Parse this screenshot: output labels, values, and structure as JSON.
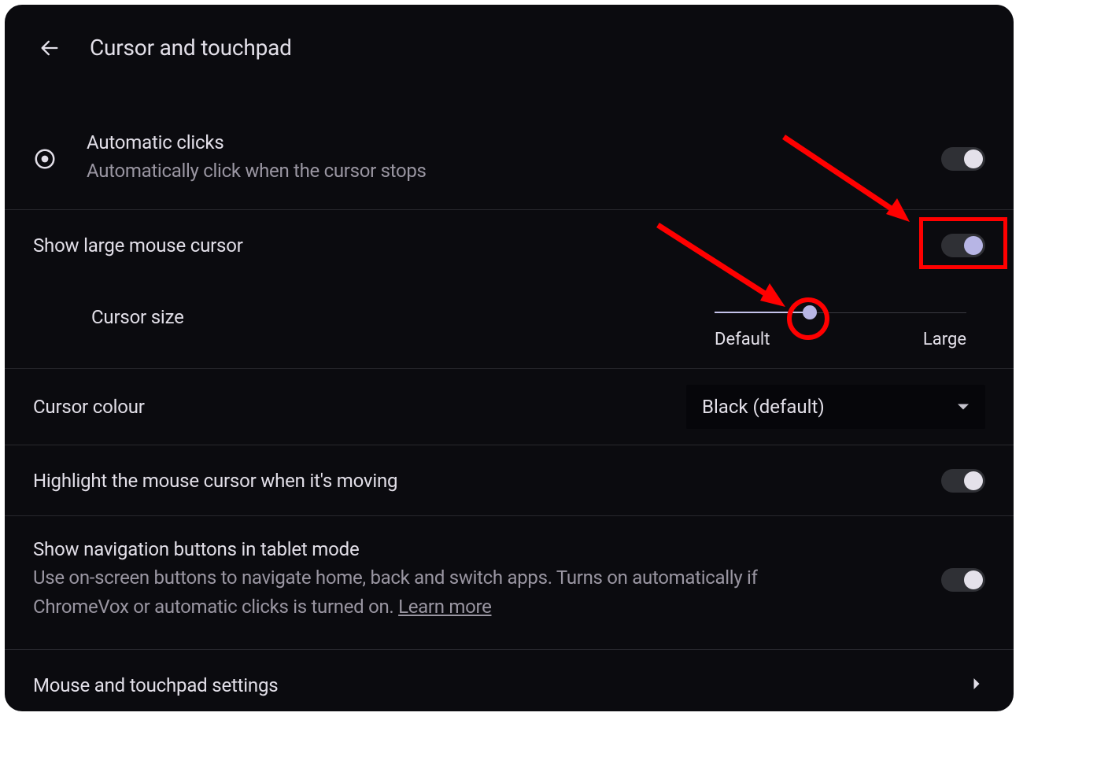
{
  "header": {
    "title": "Cursor and touchpad"
  },
  "settings": {
    "automatic_clicks": {
      "title": "Automatic clicks",
      "subtitle": "Automatically click when the cursor stops"
    },
    "large_cursor": {
      "title": "Show large mouse cursor"
    },
    "cursor_size": {
      "title": "Cursor size",
      "label_min": "Default",
      "label_max": "Large"
    },
    "cursor_colour": {
      "title": "Cursor colour",
      "value": "Black (default)"
    },
    "highlight_cursor": {
      "title": "Highlight the mouse cursor when it's moving"
    },
    "nav_buttons": {
      "title": "Show navigation buttons in tablet mode",
      "subtitle_part1": "Use on-screen buttons to navigate home, back and switch apps. Turns on automatically if ChromeVox or automatic clicks is turned on. ",
      "learn_more": "Learn more"
    },
    "mouse_touchpad": {
      "title": "Mouse and touchpad settings"
    }
  }
}
